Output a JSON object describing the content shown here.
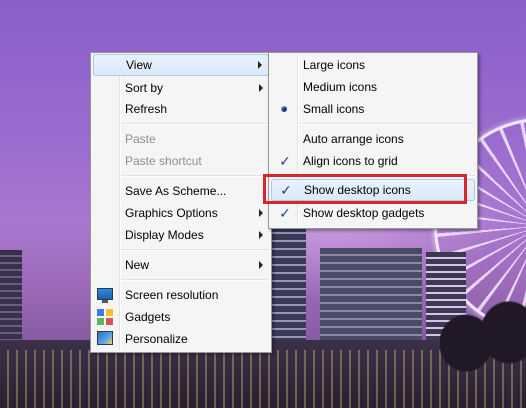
{
  "main_menu": {
    "items": [
      {
        "label": "View",
        "submenu": true,
        "state": "hover"
      },
      {
        "label": "Sort by",
        "submenu": true
      },
      {
        "label": "Refresh"
      },
      {
        "label": "Paste",
        "disabled": true
      },
      {
        "label": "Paste shortcut",
        "disabled": true
      },
      {
        "label": "Save As Scheme..."
      },
      {
        "label": "Graphics Options",
        "submenu": true
      },
      {
        "label": "Display Modes",
        "submenu": true
      },
      {
        "label": "New",
        "submenu": true
      },
      {
        "label": "Screen resolution",
        "icon": "monitor-icon"
      },
      {
        "label": "Gadgets",
        "icon": "gadgets-icon"
      },
      {
        "label": "Personalize",
        "icon": "personalize-icon"
      }
    ]
  },
  "view_submenu": {
    "items": [
      {
        "label": "Large icons"
      },
      {
        "label": "Medium icons"
      },
      {
        "label": "Small icons",
        "selected": true
      },
      {
        "label": "Auto arrange icons"
      },
      {
        "label": "Align icons to grid",
        "checked": true
      },
      {
        "label": "Show desktop icons",
        "checked": true,
        "state": "hover"
      },
      {
        "label": "Show desktop gadgets",
        "checked": true
      }
    ]
  },
  "glyphs": {
    "check": "✓"
  },
  "colors": {
    "highlight_border": "#d9262c",
    "menu_background": "#f5f5f5",
    "hover_border": "#a8c8ec",
    "disabled_text": "#8d8d8d"
  }
}
